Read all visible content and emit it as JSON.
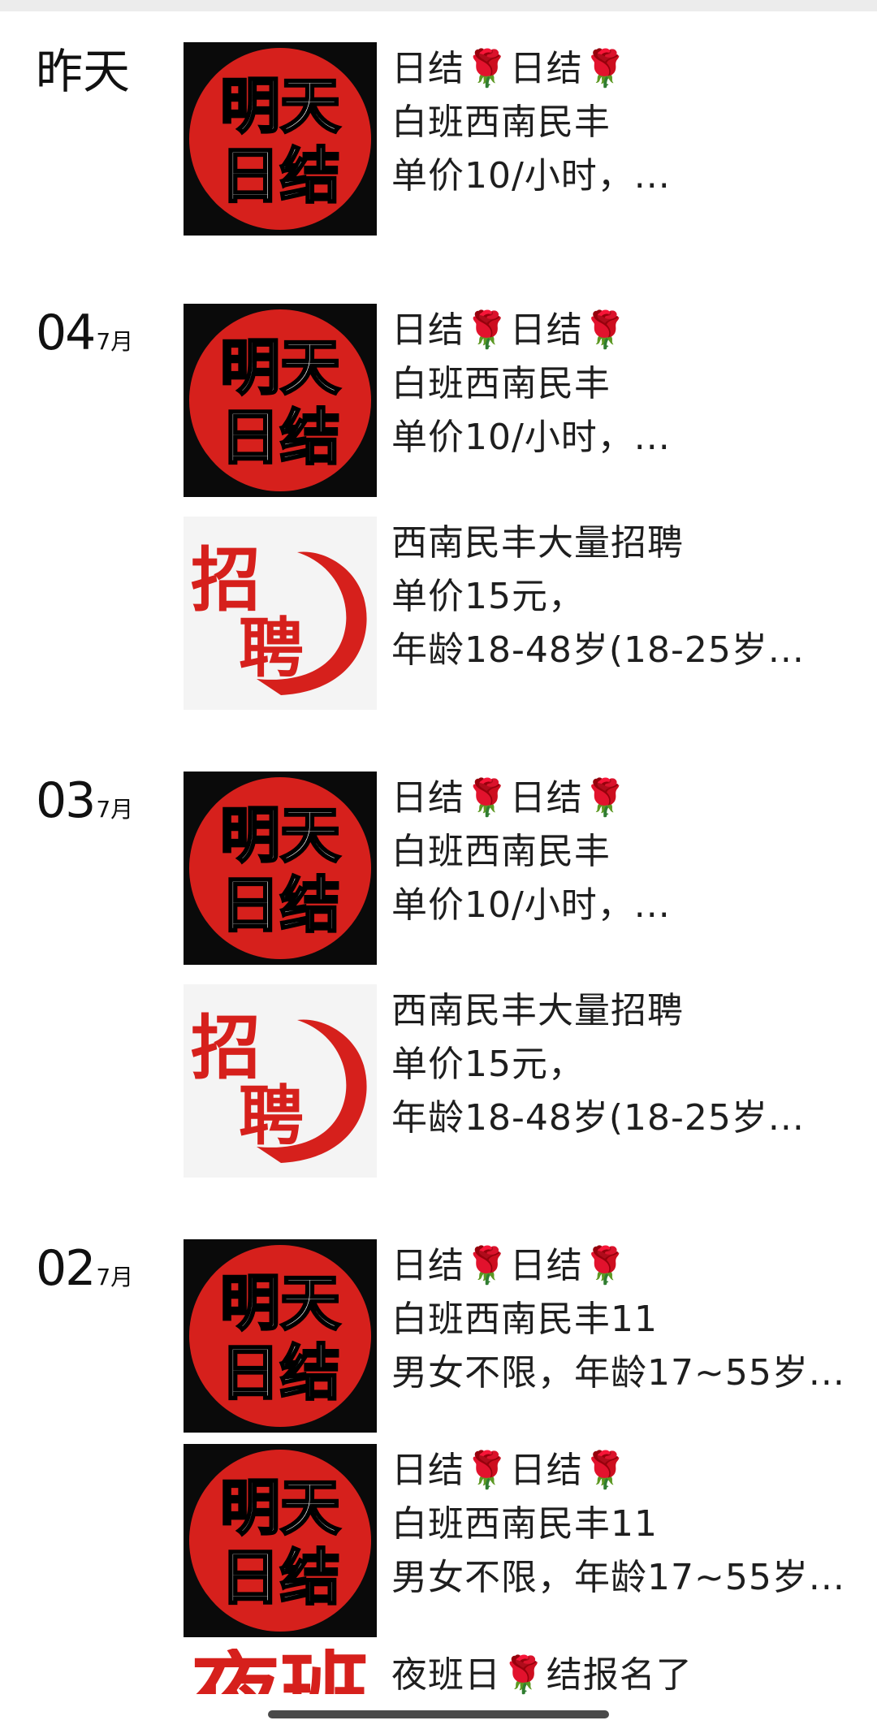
{
  "days": [
    {
      "date_label": "昨天",
      "entries": [
        {
          "thumb": "mingtian-rijie",
          "thumb_text": [
            "明天",
            "日结"
          ],
          "lines": [
            "日结🌹日结🌹",
            "白班西南民丰",
            "单价10/小时，..."
          ]
        }
      ]
    },
    {
      "date_day": "04",
      "date_month": "7月",
      "entries": [
        {
          "thumb": "mingtian-rijie",
          "thumb_text": [
            "明天",
            "日结"
          ],
          "lines": [
            "日结🌹日结🌹",
            "白班西南民丰",
            "单价10/小时，..."
          ]
        },
        {
          "thumb": "zhaopin",
          "thumb_text": [
            "招",
            "聘"
          ],
          "lines": [
            "西南民丰大量招聘",
            "单价15元，",
            "年龄18-48岁(18-25岁..."
          ]
        }
      ]
    },
    {
      "date_day": "03",
      "date_month": "7月",
      "entries": [
        {
          "thumb": "mingtian-rijie",
          "thumb_text": [
            "明天",
            "日结"
          ],
          "lines": [
            "日结🌹日结🌹",
            "白班西南民丰",
            "单价10/小时，..."
          ]
        },
        {
          "thumb": "zhaopin",
          "thumb_text": [
            "招",
            "聘"
          ],
          "lines": [
            "西南民丰大量招聘",
            "单价15元，",
            "年龄18-48岁(18-25岁..."
          ]
        }
      ]
    },
    {
      "date_day": "02",
      "date_month": "7月",
      "entries": [
        {
          "thumb": "mingtian-rijie",
          "thumb_text": [
            "明天",
            "日结"
          ],
          "lines": [
            "日结🌹日结🌹",
            "白班西南民丰11",
            "男女不限，年龄17~55岁..."
          ]
        },
        {
          "thumb": "mingtian-rijie",
          "thumb_text": [
            "明天",
            "日结"
          ],
          "lines": [
            "日结🌹日结🌹",
            "白班西南民丰11",
            "男女不限，年龄17~55岁..."
          ]
        },
        {
          "thumb": "yeban",
          "thumb_text": [
            "夜班"
          ],
          "lines": [
            "夜班日🌹结报名了"
          ]
        }
      ]
    }
  ],
  "colors": {
    "brand_red": "#d6201c",
    "thumb_black": "#0a0a0a"
  }
}
